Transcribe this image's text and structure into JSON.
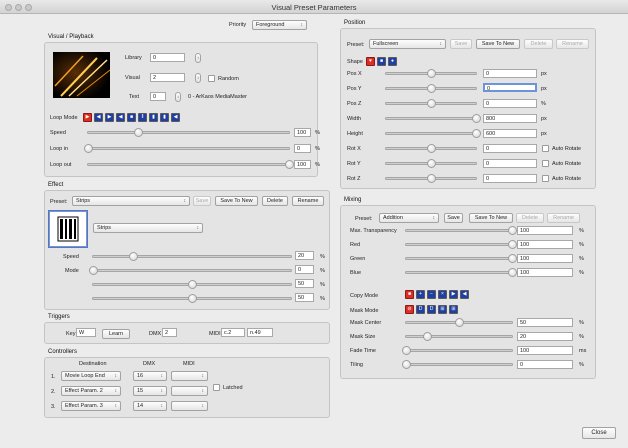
{
  "window": {
    "title": "Visual Preset Parameters"
  },
  "priority": {
    "label": "Priority",
    "value": "Foreground"
  },
  "visual_playback": {
    "section_title": "Visual / Playback",
    "library_label": "Library",
    "library_value": "0",
    "visual_label": "Visual",
    "visual_value": "2",
    "random_label": "Random",
    "text_label": "Text",
    "text_value": "0",
    "text_caption": "0 - ArKaos MediaMaster",
    "loop_mode_label": "Loop Mode",
    "loop_mode_icons": [
      "loop-forward-icon",
      "rewind-icon",
      "play-icon",
      "play-reverse-icon",
      "stop-icon",
      "pause-icon",
      "skip-start-icon",
      "skip-end-icon",
      "previous-icon"
    ],
    "speed_label": "Speed",
    "speed_value": "100",
    "speed_level": 0.25,
    "speed_unit": "%",
    "loop_in_label": "Loop in",
    "loop_in_value": "0",
    "loop_in_level": 0.0,
    "loop_in_unit": "%",
    "loop_out_label": "Loop out",
    "loop_out_value": "100",
    "loop_out_level": 1.0,
    "loop_out_unit": "%"
  },
  "effect": {
    "section_title": "Effect",
    "preset_label": "Preset:",
    "preset_value": "Strips",
    "save_label": "Save",
    "save_new_label": "Save To New",
    "delete_label": "Delete",
    "rename_label": "Rename",
    "effect_value": "Strips",
    "speed_label": "Speed",
    "mode_label": "Mode",
    "params": [
      {
        "value": "20",
        "unit": "%",
        "level": 0.2
      },
      {
        "value": "0",
        "unit": "%",
        "level": 0.0
      },
      {
        "value": "50",
        "unit": "%",
        "level": 0.5
      },
      {
        "value": "50",
        "unit": "%",
        "level": 0.5
      }
    ]
  },
  "triggers": {
    "section_title": "Triggers",
    "key_label": "Key",
    "key_value": "W",
    "learn_label": "Learn",
    "dmx_label": "DMX",
    "dmx_value": "2",
    "midi_label": "MIDI",
    "midi_channel": "c.2",
    "midi_note": "n.49"
  },
  "controllers": {
    "section_title": "Controllers",
    "destination_header": "Destination",
    "dmx_header": "DMX",
    "midi_header": "MIDI",
    "latched_label": "Latched",
    "rows": [
      {
        "num": "1.",
        "destination": "Movie Loop End",
        "dmx": "16",
        "midi": ""
      },
      {
        "num": "2.",
        "destination": "Effect Param. 2",
        "dmx": "15",
        "midi": ""
      },
      {
        "num": "3.",
        "destination": "Effect Param. 3",
        "dmx": "14",
        "midi": ""
      }
    ]
  },
  "position": {
    "section_title": "Position",
    "preset_label": "Preset:",
    "preset_value": "Fullscreen",
    "save_label": "Save",
    "save_new_label": "Save To New",
    "delete_label": "Delete",
    "rename_label": "Rename",
    "shape_label": "Shape",
    "shape_icons": [
      "shape-heart-icon",
      "shape-square-icon",
      "shape-circle-icon"
    ],
    "auto_rotate_label": "Auto Rotate",
    "params": [
      {
        "label": "Pos X",
        "value": "0",
        "unit": "px",
        "level": 0.5,
        "auto": false
      },
      {
        "label": "Pos Y",
        "value": "0",
        "unit": "px",
        "level": 0.5,
        "auto": false
      },
      {
        "label": "Pos Z",
        "value": "0",
        "unit": "%",
        "level": 0.5,
        "auto": false
      },
      {
        "label": "Width",
        "value": "800",
        "unit": "px",
        "level": 1.0,
        "auto": false
      },
      {
        "label": "Height",
        "value": "600",
        "unit": "px",
        "level": 1.0,
        "auto": false
      },
      {
        "label": "Rot X",
        "value": "0",
        "unit": "",
        "level": 0.5,
        "auto": true
      },
      {
        "label": "Rot Y",
        "value": "0",
        "unit": "",
        "level": 0.5,
        "auto": true
      },
      {
        "label": "Rot Z",
        "value": "0",
        "unit": "",
        "level": 0.5,
        "auto": true
      }
    ]
  },
  "mixing": {
    "section_title": "Mixing",
    "preset_label": "Preset:",
    "preset_value": "Addition",
    "save_label": "Save",
    "save_new_label": "Save To New",
    "delete_label": "Delete",
    "rename_label": "Rename",
    "copy_mode_label": "Copy Mode",
    "copy_mode_icons": [
      "copy-mode-normal-icon",
      "copy-mode-add-icon",
      "copy-mode-subtract-icon",
      "copy-mode-multiply-icon",
      "copy-mode-right-icon",
      "copy-mode-left-icon"
    ],
    "mask_mode_label": "Mask Mode",
    "mask_mode_icons": [
      "mask-none-icon",
      "mask-dw-icon",
      "mask-dn-icon",
      "mask-grid-icon",
      "mask-grid-alt-icon"
    ],
    "top_params": [
      {
        "label": "Max. Transparency",
        "value": "100",
        "unit": "%",
        "level": 1.0
      },
      {
        "label": "Red",
        "value": "100",
        "unit": "%",
        "level": 1.0
      },
      {
        "label": "Green",
        "value": "100",
        "unit": "%",
        "level": 1.0
      },
      {
        "label": "Blue",
        "value": "100",
        "unit": "%",
        "level": 1.0
      }
    ],
    "bottom_params": [
      {
        "label": "Mask Center",
        "value": "50",
        "unit": "%",
        "level": 0.5
      },
      {
        "label": "Mask Size",
        "value": "20",
        "unit": "%",
        "level": 0.2
      },
      {
        "label": "Fade Time",
        "value": "100",
        "unit": "ms",
        "level": 0.0
      },
      {
        "label": "Tiling",
        "value": "0",
        "unit": "%",
        "level": 0.0
      }
    ]
  },
  "close_label": "Close"
}
